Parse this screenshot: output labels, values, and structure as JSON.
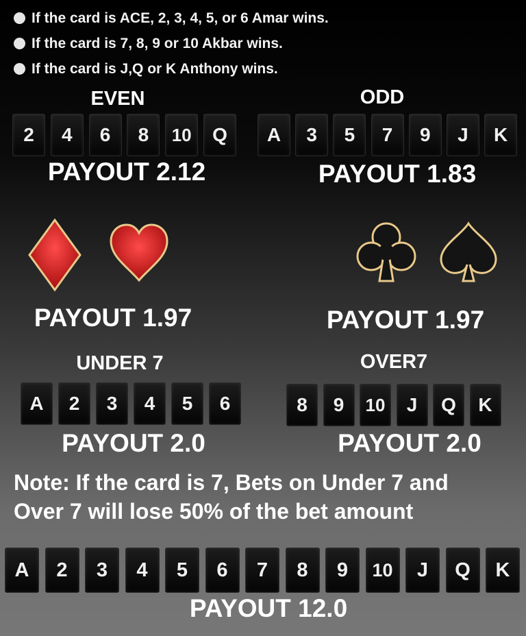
{
  "rules": [
    "If the card is ACE, 2, 3, 4, 5, or 6 Amar wins.",
    "If the card is 7, 8, 9 or 10 Akbar wins.",
    "If the card is J,Q or K Anthony wins."
  ],
  "even": {
    "title": "EVEN",
    "cards": [
      "2",
      "4",
      "6",
      "8",
      "10",
      "Q"
    ],
    "payout": "PAYOUT 2.12"
  },
  "odd": {
    "title": "ODD",
    "cards": [
      "A",
      "3",
      "5",
      "7",
      "9",
      "J",
      "K"
    ],
    "payout": "PAYOUT 1.83"
  },
  "red": {
    "icons": [
      "diamond-icon",
      "heart-icon"
    ],
    "color": "#d81e1e",
    "payout": "PAYOUT 1.97"
  },
  "black": {
    "icons": [
      "club-icon",
      "spade-icon"
    ],
    "color": "#151515",
    "payout": "PAYOUT 1.97"
  },
  "under7": {
    "title": "UNDER 7",
    "cards": [
      "A",
      "2",
      "3",
      "4",
      "5",
      "6"
    ],
    "payout": "PAYOUT 2.0"
  },
  "over7": {
    "title": "OVER7",
    "cards": [
      "8",
      "9",
      "10",
      "J",
      "Q",
      "K"
    ],
    "payout": "PAYOUT 2.0"
  },
  "note": {
    "line1": "Note: If the card is 7,  Bets on Under 7 and",
    "line2": "Over 7 will lose 50% of the bet amount"
  },
  "all_cards": {
    "cards": [
      "A",
      "2",
      "3",
      "4",
      "5",
      "6",
      "7",
      "8",
      "9",
      "10",
      "J",
      "Q",
      "K"
    ],
    "payout": "PAYOUT 12.0"
  },
  "colors": {
    "suit_border": "#e8c98a",
    "card_bg": "#0a0a0a"
  }
}
